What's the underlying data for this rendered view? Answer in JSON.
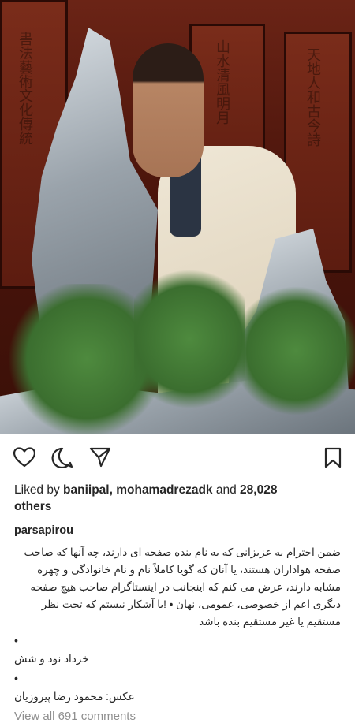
{
  "post": {
    "photo_label": "photo-post-image",
    "actions": {
      "like_icon": "heart-icon",
      "comment_icon": "comment-icon",
      "share_icon": "share-icon",
      "save_icon": "bookmark-icon"
    },
    "likes": {
      "prefix": "Liked by ",
      "users": "baniipal, mohamadrezadk",
      "connector": " and ",
      "count": "28,028",
      "suffix": "others"
    },
    "caption": {
      "username": "parsapirou",
      "text": "ضمن احترام به عزیزانی که به نام بنده صفحه ای دارند، چه آنها که صاحب صفحه هواداران هستند، یا آنان که گویا کاملاً نام و نام خانوادگی و چهره مشابه دارند، عرض می کنم که اینجانب در اینستاگرام صاحب هیچ صفحه دیگری اعم از خصوصی، عمومی، نهان • !یا آشکار نیستم که تحت نظر مستقیم یا غیر مستقیم بنده باشد",
      "bullet1": "•",
      "date_line": "خرداد نود و شش",
      "bullet2": "•",
      "credit_line": "عکس: محمود رضا پیروزیان"
    },
    "view_comments": "View all 691 comments"
  }
}
